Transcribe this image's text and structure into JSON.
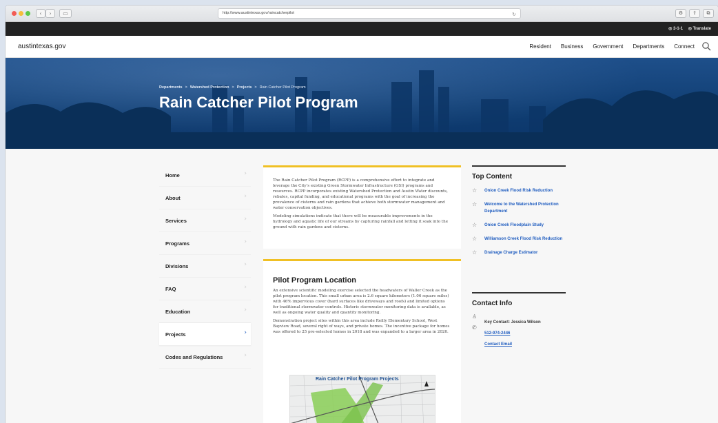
{
  "browser": {
    "url": "http://www.austintexas.gov/raincatcherpilot",
    "back_glyph": "‹",
    "forward_glyph": "›",
    "sidebar_glyph": "▭",
    "reload_glyph": "↻"
  },
  "utility_bar": {
    "items": [
      "3-1-1",
      "Translate"
    ]
  },
  "header": {
    "logo": "austintexas.gov",
    "nav": [
      "Resident",
      "Business",
      "Government",
      "Departments",
      "Connect"
    ]
  },
  "hero": {
    "breadcrumbs": [
      "Departments",
      "Watershed Protection",
      "Projects",
      "Rain Catcher Pilot Program"
    ],
    "separator": ">",
    "title": "Rain Catcher Pilot Program"
  },
  "sidebar": {
    "chevron": "›",
    "items": [
      {
        "label": "Home"
      },
      {
        "label": "About"
      },
      {
        "label": "Services"
      },
      {
        "label": "Programs"
      },
      {
        "label": "Divisions"
      },
      {
        "label": "FAQ"
      },
      {
        "label": "Education"
      },
      {
        "label": "Projects",
        "active": true
      },
      {
        "label": "Codes and Regulations"
      }
    ]
  },
  "intro_card": {
    "paragraphs": [
      "The Rain Catcher Pilot Program (RCPP) is a comprehensive effort to integrate and leverage the City's existing Green Stormwater Infrastructure (GSI) programs and resources. RCPP incorporates existing Watershed Protection and Austin Water discounts, rebates, capital funding, and educational programs with the goal of increasing the prevalence of cisterns and rain gardens that achieve both stormwater management and water conservation objectives.",
      "Modeling simulations indicate that there will be measurable improvements in the hydrology and aquatic life of our streams by capturing rainfall and letting it soak into the ground with rain gardens and cisterns."
    ]
  },
  "location_card": {
    "heading": "Pilot Program Location",
    "paragraphs": [
      "An extensive scientific modeling exercise selected the headwaters of Waller Creek as the pilot program location. This small urban area is 2.6 square kilometers (1.06 square miles) with 46% impervious cover (hard surfaces like driveways and roofs) and limited options for traditional stormwater controls. Historic stormwater monitoring data is available, as well as ongoing water quality and quantity monitoring.",
      "Demonstration project sites within this area include Reilly Elementary School, West Bayview Road, several right of ways, and private homes. The incentive package for homes was offered to 25 pre-selected homes in 2018 and was expanded to a larger area in 2020."
    ],
    "map_title": "Rain Catcher Pilot Program Projects"
  },
  "top_content": {
    "heading": "Top Content",
    "items": [
      "Onion Creek Flood Risk Reduction",
      "Welcome to the Watershed Protection Department",
      "Onion Creek Floodplain Study",
      "Williamson Creek Flood Risk Reduction",
      "Drainage Charge Estimator"
    ]
  },
  "contact": {
    "heading": "Contact Info",
    "key_contact": "Key Contact: Jessica Wilson",
    "phone": "512-974-2446",
    "email_label": "Contact Email"
  },
  "colors": {
    "accent_blue": "#1d5bbf",
    "hero_blue": "#0f3d72",
    "card_rule": "#f0c024"
  }
}
